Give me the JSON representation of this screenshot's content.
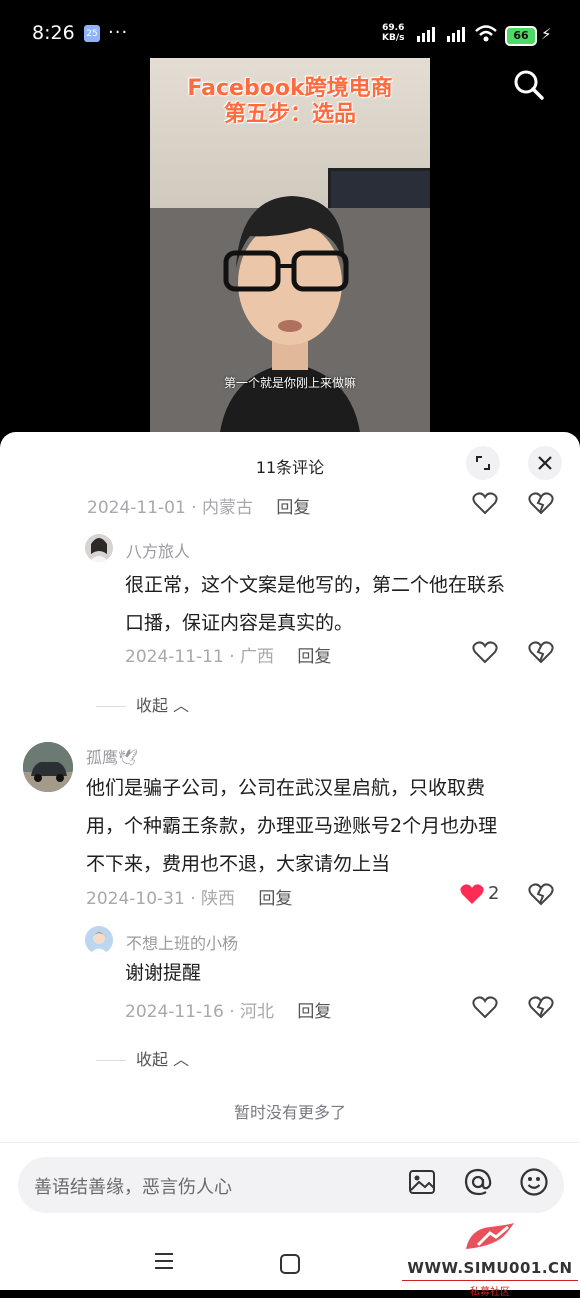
{
  "status_bar": {
    "time": "8:26",
    "calendar_day": "25",
    "more": "···",
    "net_speed_value": "69.6",
    "net_speed_unit": "KB/s",
    "battery": "66"
  },
  "video": {
    "title_line1": "Facebook跨境电商",
    "title_line2": "第五步：选品",
    "subtitle": "第一个就是你刚上来做嘛"
  },
  "comments_panel": {
    "title": "11条评论",
    "reply_label": "回复",
    "collapse_label": "收起",
    "no_more": "暂时没有更多了",
    "items": [
      {
        "date": "2024-11-01",
        "region": "内蒙古"
      },
      {
        "user": "八方旅人",
        "text_line1": "很正常，这个文案是他写的，第二个他在联系",
        "text_line2": "口播，保证内容是真实的。",
        "date": "2024-11-11",
        "region": "广西"
      },
      {
        "user": "孤鹰🕊",
        "text_line1": "他们是骗子公司，公司在武汉星启航，只收取费",
        "text_line2": "用，个种霸王条款，办理亚马逊账号2个月也办理",
        "text_line3": "不下来，费用也不退，大家请勿上当",
        "date": "2024-10-31",
        "region": "陕西",
        "likes": "2"
      },
      {
        "user": "不想上班的小杨",
        "text_line1": "谢谢提醒",
        "date": "2024-11-16",
        "region": "河北"
      }
    ]
  },
  "input": {
    "placeholder": "善语结善缘，恶言伤人心"
  },
  "watermark": {
    "url": "WWW.SIMU001.CN",
    "tag": "私募社区"
  },
  "colors": {
    "liked_heart": "#fe2c55"
  }
}
